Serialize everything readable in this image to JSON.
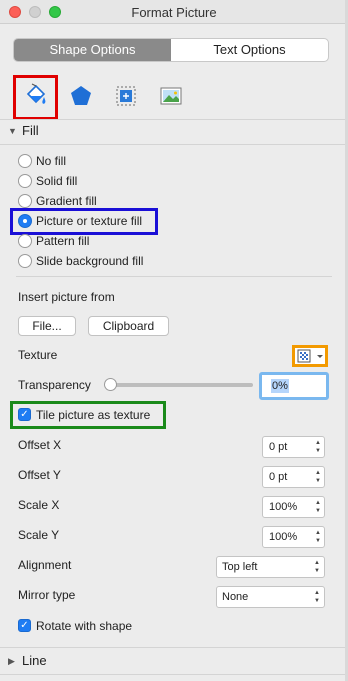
{
  "window": {
    "title": "Format Picture"
  },
  "tabs": [
    {
      "label": "Shape Options",
      "active": true
    },
    {
      "label": "Text Options",
      "active": false
    }
  ],
  "icons": [
    "fill-line-icon",
    "effects-icon",
    "size-properties-icon",
    "picture-icon"
  ],
  "fill": {
    "header": "Fill",
    "options": [
      {
        "label": "No fill",
        "selected": false
      },
      {
        "label": "Solid fill",
        "selected": false
      },
      {
        "label": "Gradient fill",
        "selected": false
      },
      {
        "label": "Picture or texture fill",
        "selected": true
      },
      {
        "label": "Pattern fill",
        "selected": false
      },
      {
        "label": "Slide background fill",
        "selected": false
      }
    ],
    "insert_from": "Insert picture from",
    "file_button": "File...",
    "clipboard_button": "Clipboard",
    "texture_label": "Texture",
    "transparency_label": "Transparency",
    "transparency_value": "0%",
    "transparency_level": 0,
    "tile_label": "Tile picture as texture",
    "tile_checked": true,
    "offset_x_label": "Offset X",
    "offset_x_value": "0 pt",
    "offset_y_label": "Offset Y",
    "offset_y_value": "0 pt",
    "scale_x_label": "Scale X",
    "scale_x_value": "100%",
    "scale_y_label": "Scale Y",
    "scale_y_value": "100%",
    "alignment_label": "Alignment",
    "alignment_value": "Top left",
    "mirror_label": "Mirror type",
    "mirror_value": "None",
    "rotate_label": "Rotate with shape",
    "rotate_checked": true
  },
  "line": {
    "header": "Line"
  },
  "colors": {
    "accent": "#1f7cf3",
    "highlight_red": "#e00000",
    "highlight_blue": "#1a0fd6",
    "highlight_green": "#1a8a1a",
    "highlight_orange": "#f39a00"
  }
}
